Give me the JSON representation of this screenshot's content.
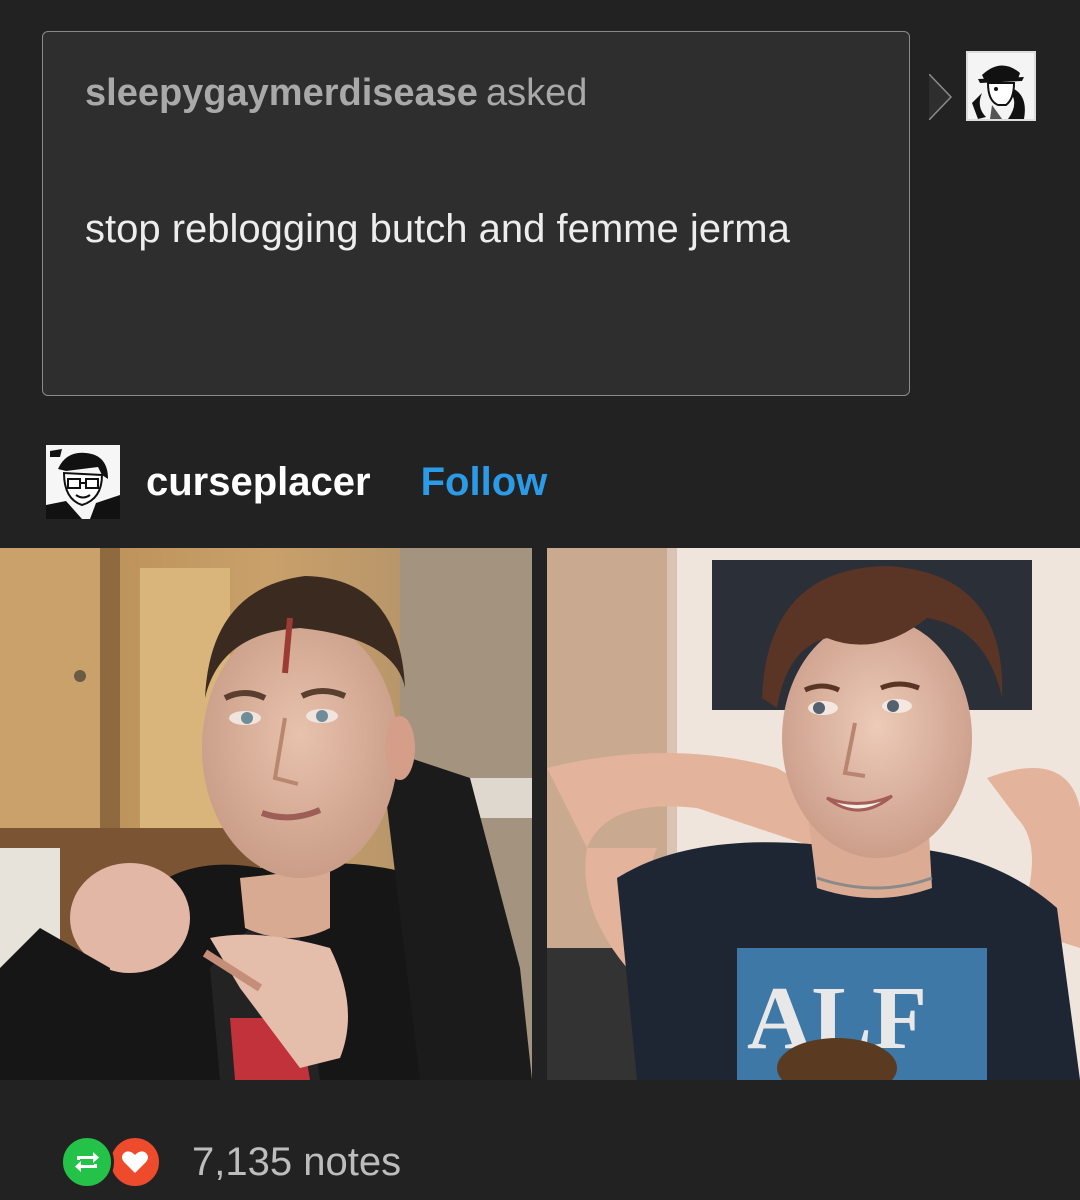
{
  "ask": {
    "asker": "sleepygaymerdisease",
    "verb": "asked",
    "question": "stop reblogging butch and femme jerma"
  },
  "answer": {
    "blog_name": "curseplacer",
    "follow_label": "Follow"
  },
  "footer": {
    "notes": "7,135 notes"
  },
  "icons": {
    "reblog": "reblog-icon",
    "like": "heart-icon"
  },
  "colors": {
    "background": "#222222",
    "ask_box": "#2e2e2e",
    "follow": "#2b9be8",
    "reblog": "#25c24a",
    "like": "#ee4a2c"
  }
}
